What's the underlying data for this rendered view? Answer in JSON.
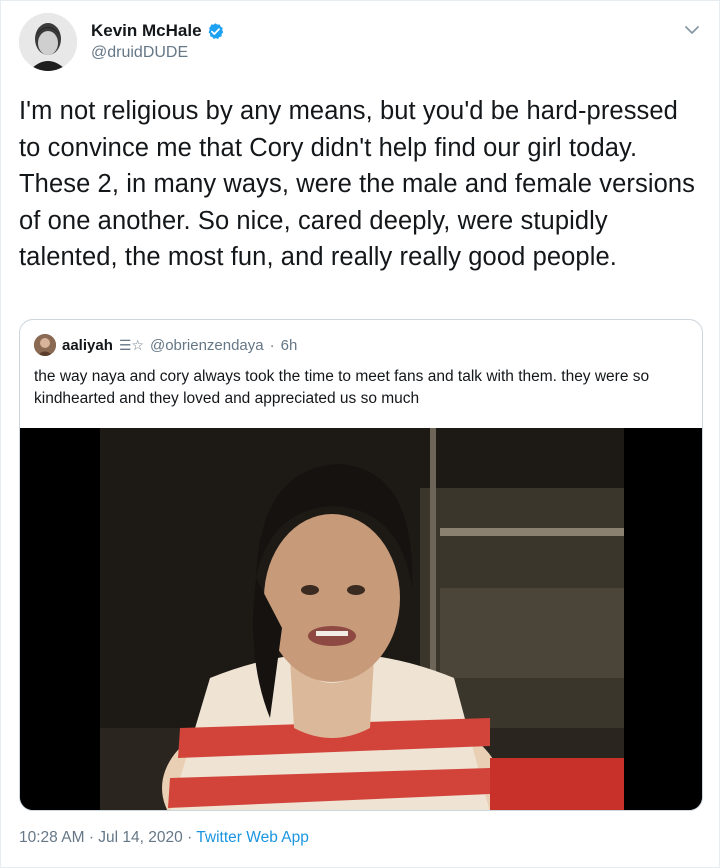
{
  "author": {
    "name": "Kevin McHale",
    "handle": "@druidDUDE",
    "verified": true
  },
  "tweet": {
    "text": "I'm not religious by any means, but you'd be hard-pressed to convince me that Cory didn't help find our girl today. These 2, in many ways, were the male and female versions of one another. So nice, cared deeply, were stupidly talented, the most fun, and really really good people."
  },
  "quoted_tweet": {
    "name": "aaliyah",
    "name_glyphs": "☰☆",
    "handle": "@obrienzendaya",
    "separator": "·",
    "time": "6h",
    "text": "the way naya and cory always took the time to meet fans and talk with them. they were so kindhearted and they loved and appreciated us so much"
  },
  "meta": {
    "time": "10:28 AM",
    "separator_1": "·",
    "date": "Jul 14, 2020",
    "separator_2": "·",
    "app": "Twitter Web App"
  },
  "colors": {
    "text": "#14171a",
    "secondary": "#657786",
    "accent": "#1b95e0",
    "border": "#ccd6dd"
  },
  "icons": {
    "verified": "verified-badge-icon",
    "menu": "chevron-down-icon"
  }
}
